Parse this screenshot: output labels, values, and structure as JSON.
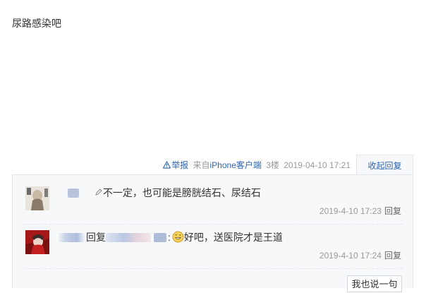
{
  "post": {
    "text": "尿路感染吧"
  },
  "post_meta": {
    "report_label": "举报",
    "source_prefix": "来自",
    "client": "iPhone客户端",
    "floor": "3楼",
    "datetime": "2019-04-10 17:21",
    "collapse_label": "收起回复"
  },
  "replies": [
    {
      "text": "不一定，也可能是膀胱结石、尿结石",
      "time": "2019-4-10 17:23",
      "reply_label": "回复"
    },
    {
      "prefix": "回复",
      "colon": ":",
      "text": "好吧，送医院才是王道",
      "time": "2019-4-10 17:24",
      "reply_label": "回复"
    }
  ],
  "say_button": "我也说一句",
  "colors": {
    "link": "#2d64b3",
    "box_bg": "#f7f8fa",
    "border": "#e3e6ec",
    "muted": "#999999"
  },
  "icons": [
    "warning-icon",
    "smile-emoji-icon",
    "pencil-icon"
  ]
}
